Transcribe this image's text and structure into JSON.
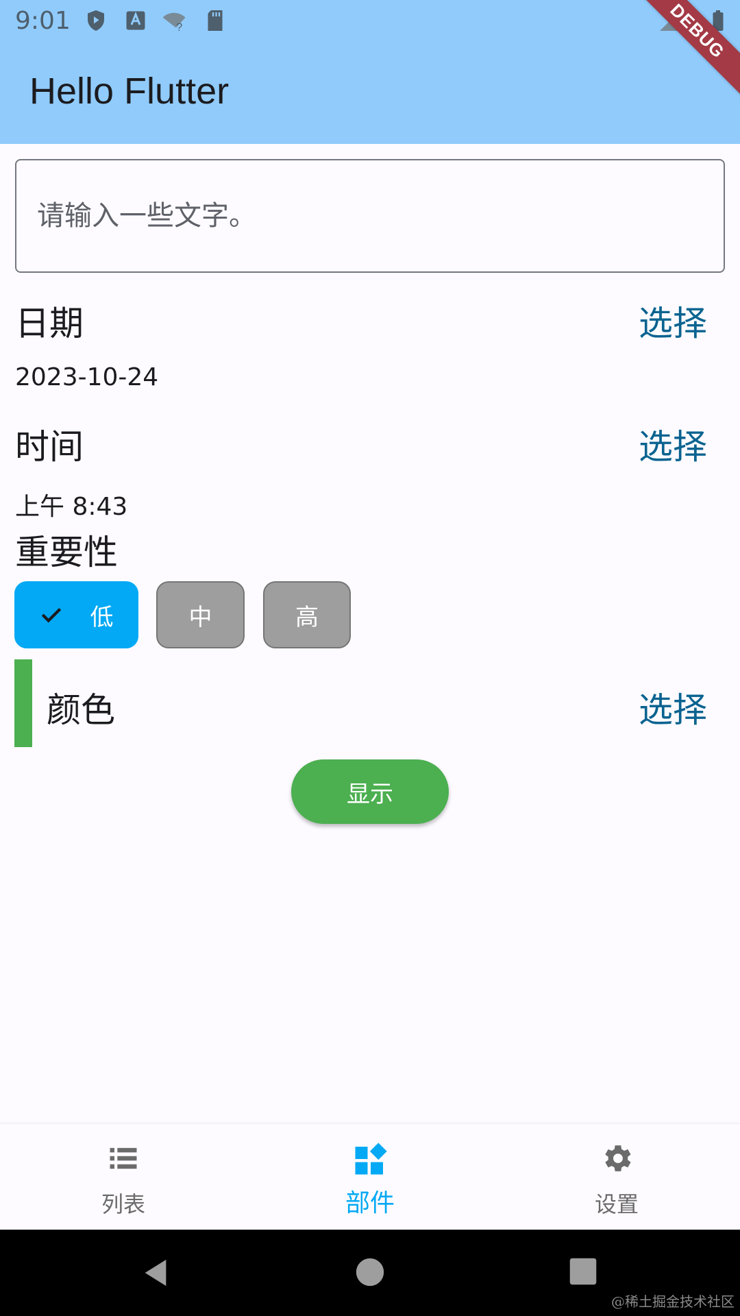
{
  "status_bar": {
    "time": "9:01"
  },
  "app_bar": {
    "title": "Hello Flutter",
    "debug_banner": "DEBUG"
  },
  "text_input": {
    "placeholder": "请输入一些文字。",
    "value": ""
  },
  "date": {
    "title": "日期",
    "select_label": "选择",
    "value": "2023-10-24"
  },
  "time": {
    "title": "时间",
    "select_label": "选择",
    "value": "上午 8:43"
  },
  "importance": {
    "title": "重要性",
    "options": [
      {
        "label": "低",
        "selected": true
      },
      {
        "label": "中",
        "selected": false
      },
      {
        "label": "高",
        "selected": false
      }
    ]
  },
  "color": {
    "title": "颜色",
    "select_label": "选择",
    "current_color": "#4caf50"
  },
  "show_button": {
    "label": "显示"
  },
  "bottom_nav": {
    "items": [
      {
        "label": "列表",
        "icon": "list-icon",
        "active": false
      },
      {
        "label": "部件",
        "icon": "widgets-icon",
        "active": true
      },
      {
        "label": "设置",
        "icon": "settings-icon",
        "active": false
      }
    ]
  },
  "watermark": "@稀土掘金技术社区",
  "colors": {
    "app_bar": "#90cbfb",
    "accent": "#03a9f4",
    "link": "#0a6390",
    "chip_unselected": "#9e9e9e",
    "green": "#4caf50"
  }
}
